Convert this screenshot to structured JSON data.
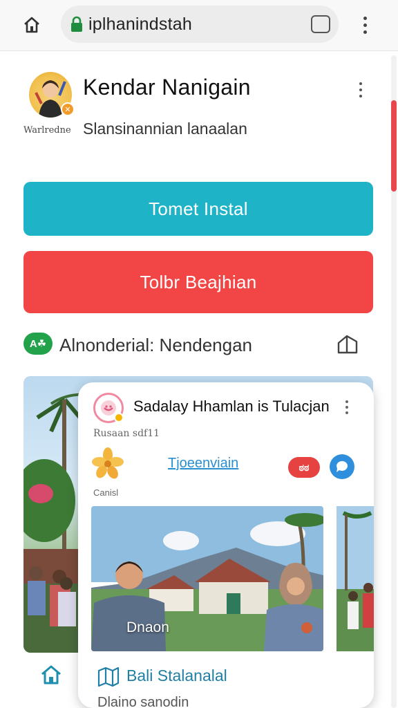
{
  "browser": {
    "url": "iplhanindstah",
    "tab_count": "",
    "icons": [
      "home-icon",
      "lock-icon",
      "tabs-icon",
      "more-vert-icon"
    ]
  },
  "profile": {
    "name": "Kendar Nanigain",
    "badge_label": "Warlredne",
    "subtitle": "Slansinannian lanaalan"
  },
  "buttons": {
    "primary_label": "Tomet Instal",
    "secondary_label": "Tolbr Beajhian"
  },
  "info_row": {
    "badge": "A☘",
    "text": "Alnonderial: Nendengan"
  },
  "card": {
    "title": "Sadalay Hhamlan is Tulacjan",
    "subtitle": "Rusaan sdf11",
    "caption": "Canisl",
    "link": "Tjoeenviain",
    "pill": "ಠಠ",
    "photo_overlay": "Dnaon",
    "bottom_label": "Bali Stalanalal",
    "bottom_sub": "Dlaino sanodin"
  },
  "colors": {
    "teal": "#1fb3c8",
    "red": "#f24545",
    "green": "#22a24a",
    "blue": "#2f8fdc",
    "scroll_accent": "#e8474f"
  }
}
